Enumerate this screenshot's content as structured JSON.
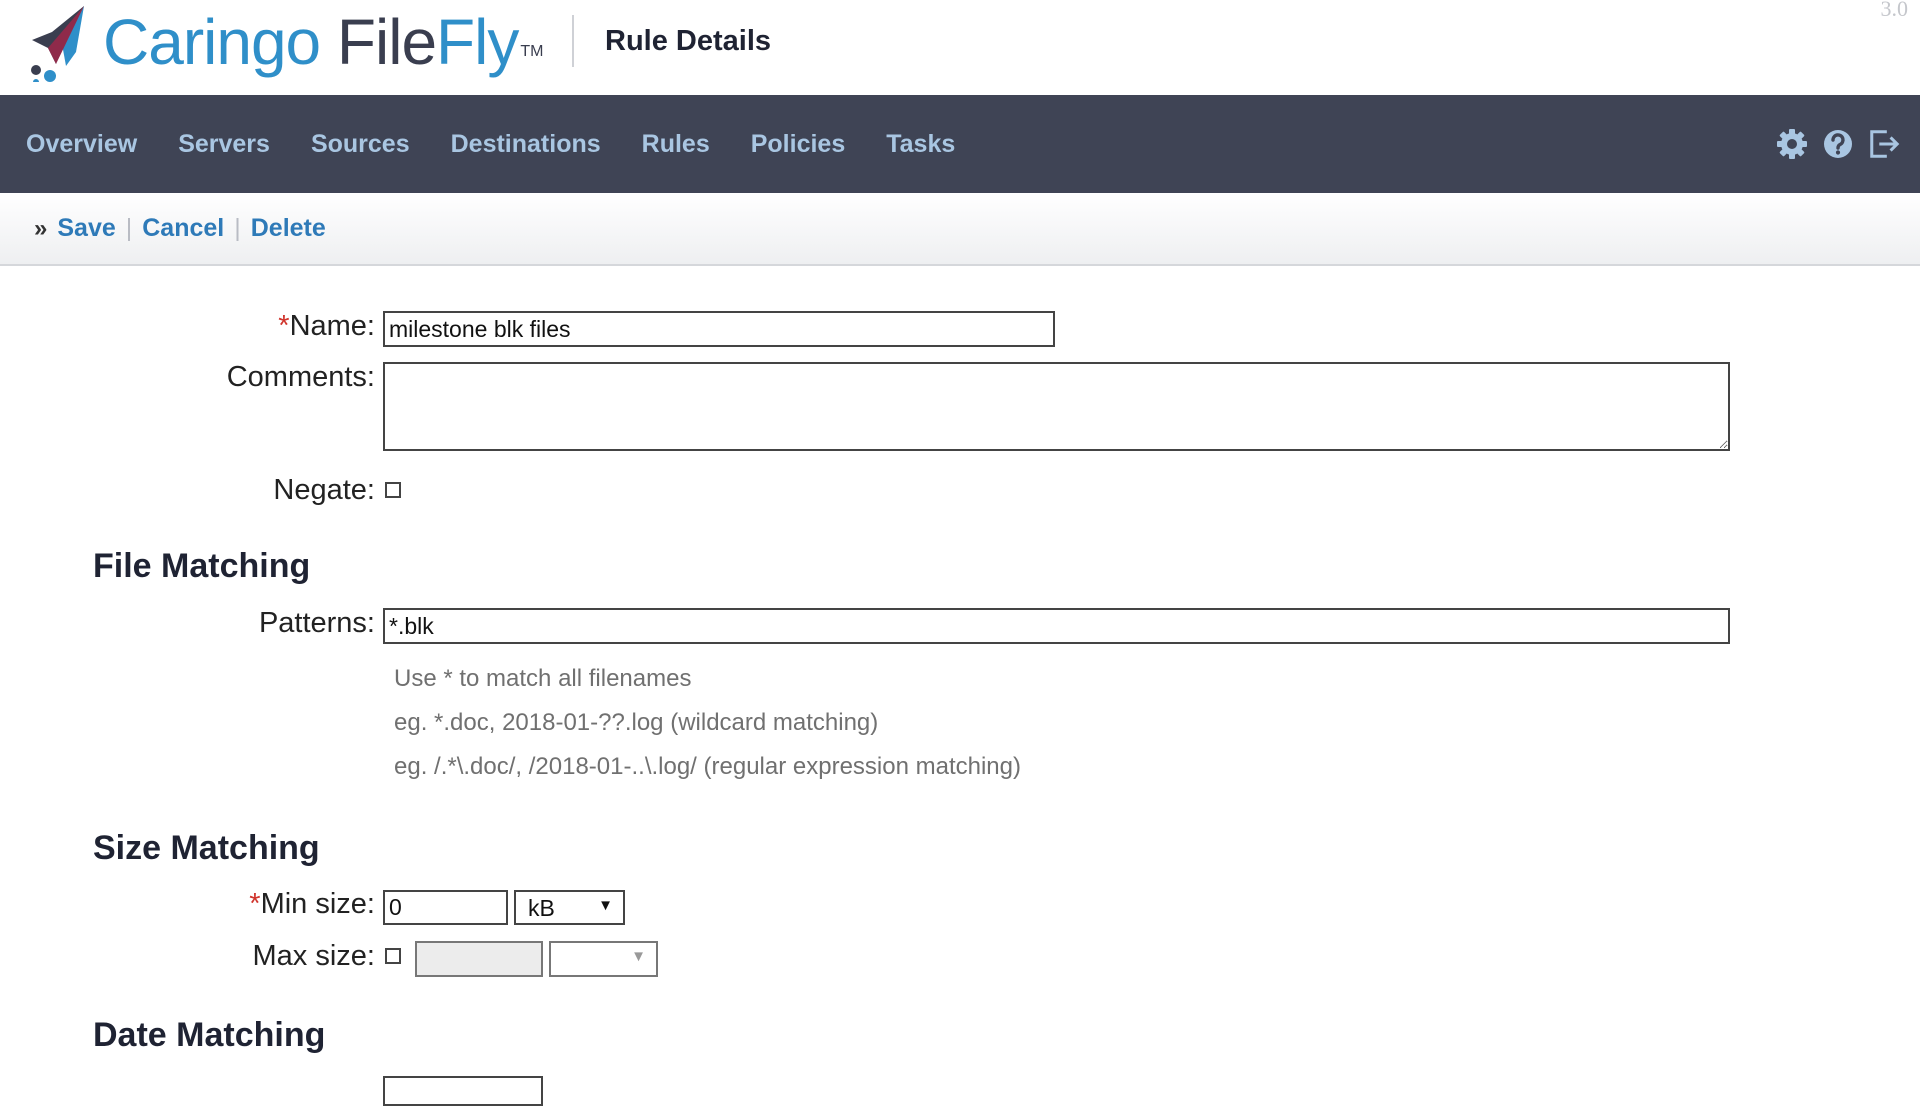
{
  "header": {
    "logo": {
      "word1": "Caringo",
      "word2": "File",
      "word3": "Fly",
      "tm": "TM"
    },
    "page_title": "Rule Details",
    "version": "3.0"
  },
  "nav": {
    "items": [
      {
        "label": "Overview"
      },
      {
        "label": "Servers"
      },
      {
        "label": "Sources"
      },
      {
        "label": "Destinations"
      },
      {
        "label": "Rules"
      },
      {
        "label": "Policies"
      },
      {
        "label": "Tasks"
      }
    ],
    "tools": [
      "gear-icon",
      "help-icon",
      "logout-icon"
    ]
  },
  "actions": {
    "prefix": "»",
    "save": "Save",
    "cancel": "Cancel",
    "delete": "Delete",
    "separator": "|"
  },
  "form": {
    "required_mark": "*",
    "name_label": "Name:",
    "name_value": "milestone blk files",
    "comments_label": "Comments:",
    "comments_value": "",
    "negate_label": "Negate:",
    "negate_checked": false
  },
  "file_matching": {
    "heading": "File Matching",
    "patterns_label": "Patterns:",
    "patterns_value": "*.blk",
    "hints": [
      "Use * to match all filenames",
      "eg. *.doc, 2018-01-??.log (wildcard matching)",
      "eg. /.*\\.doc/, /2018-01-..\\.log/ (regular expression matching)"
    ]
  },
  "size_matching": {
    "heading": "Size Matching",
    "min_label": "Min size:",
    "min_value": "0",
    "min_unit": "kB",
    "max_label": "Max size:",
    "max_checked": false,
    "max_value": "",
    "max_unit": ""
  },
  "date_matching": {
    "heading": "Date Matching"
  }
}
